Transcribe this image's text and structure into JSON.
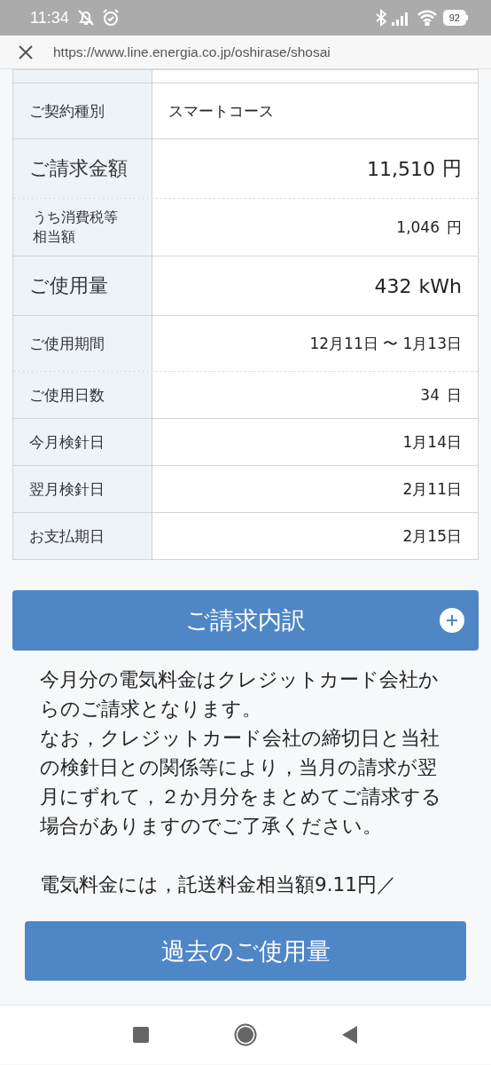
{
  "status_bar": {
    "time": "11:34",
    "battery": "92"
  },
  "address_bar": {
    "url": "https://www.line.energia.co.jp/oshirase/shosai"
  },
  "details_table": {
    "rows": [
      {
        "label": "ご契約種別",
        "value": "スマートコース",
        "kind": "text",
        "emphasized": false,
        "dashed_divider": false
      },
      {
        "label": "ご請求金額",
        "value": "11,510",
        "unit": "円",
        "kind": "amount",
        "emphasized": true,
        "dashed_divider": false
      },
      {
        "label": "うち消費税等相当額",
        "value": "1,046",
        "unit": "円",
        "kind": "amount",
        "emphasized": false,
        "dashed_divider": true
      },
      {
        "label": "ご使用量",
        "value": "432",
        "unit": "kWh",
        "kind": "amount",
        "emphasized": true,
        "dashed_divider": false
      },
      {
        "label": "ご使用期間",
        "value": "12月11日 〜 1月13日",
        "kind": "amount",
        "emphasized": false,
        "dashed_divider": false
      },
      {
        "label": "ご使用日数",
        "value": "34",
        "unit": "日",
        "kind": "amount",
        "emphasized": false,
        "dashed_divider": true
      },
      {
        "label": "今月検針日",
        "value": "1月14日",
        "kind": "amount",
        "emphasized": false,
        "dashed_divider": false
      },
      {
        "label": "翌月検針日",
        "value": "2月11日",
        "kind": "amount",
        "emphasized": false,
        "dashed_divider": false
      },
      {
        "label": "お支払期日",
        "value": "2月15日",
        "kind": "amount",
        "emphasized": false,
        "dashed_divider": false
      }
    ]
  },
  "breakdown": {
    "title": "ご請求内訳",
    "expanded": false
  },
  "notice": [
    "今月分の電気料金はクレジットカード会社からのご請求となります。",
    "なお，クレジットカード会社の締切日と当社の検針日との関係等により，当月の請求が翌月にずれて，２か月分をまとめてご請求する場合がありますのでご了承ください。",
    "電気料金には，託送料金相当額9.11円／"
  ],
  "history_button": {
    "label": "過去のご使用量"
  }
}
